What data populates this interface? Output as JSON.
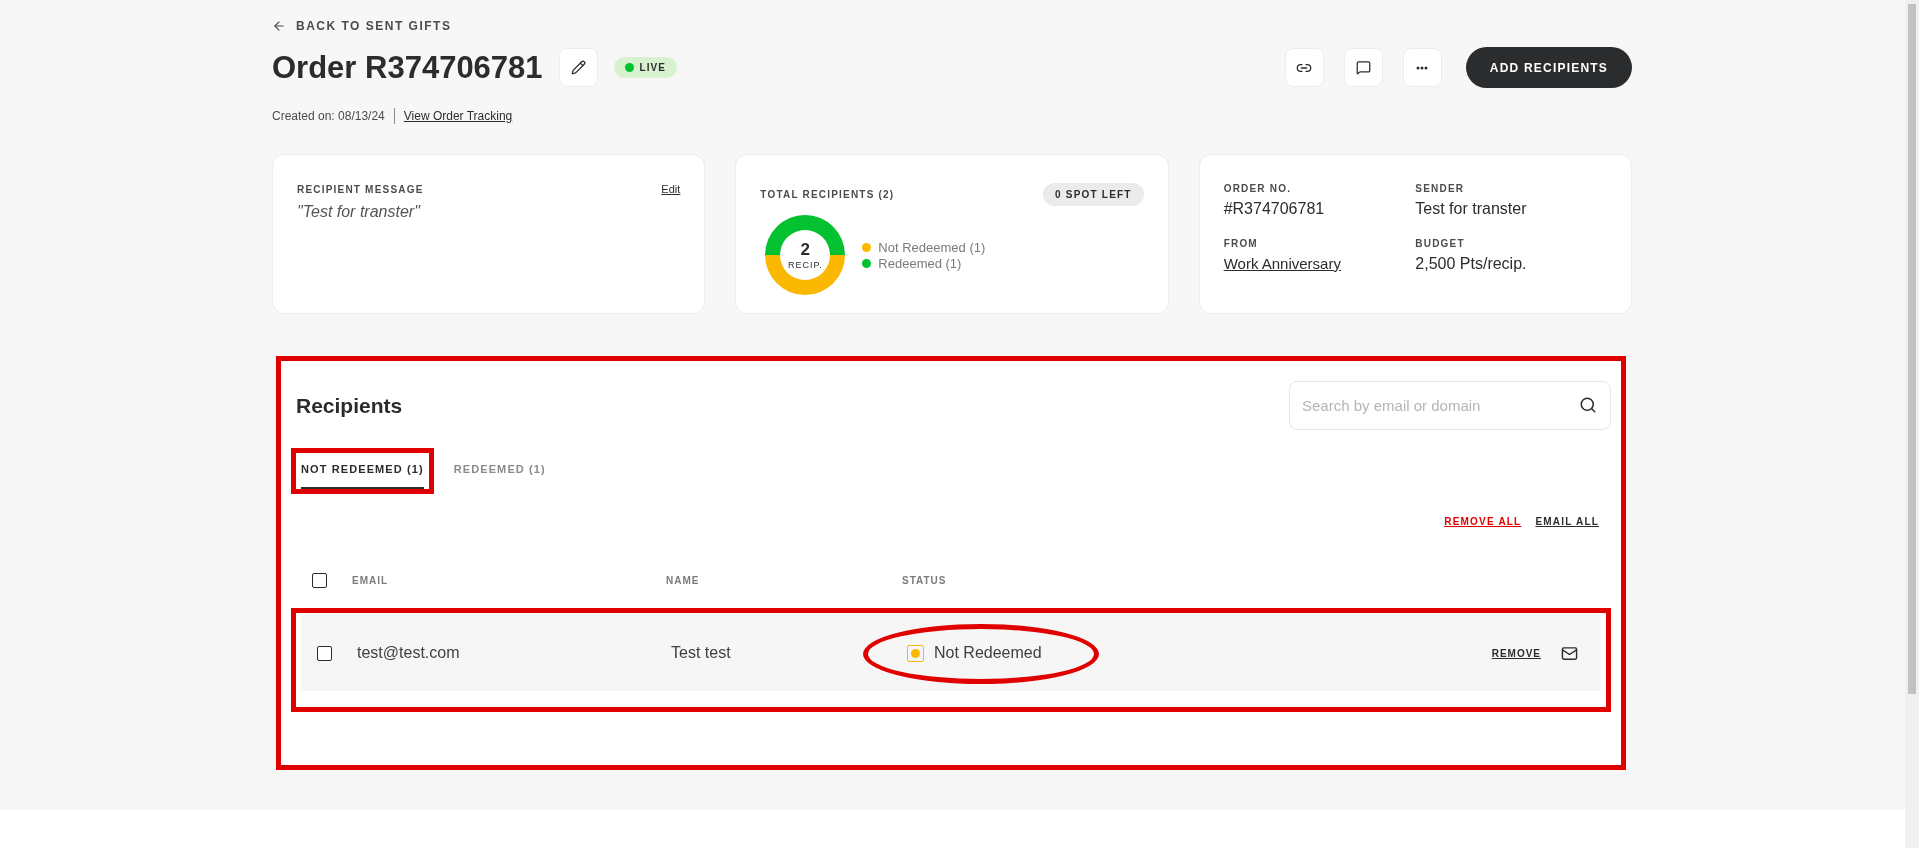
{
  "back_link": "BACK TO SENT GIFTS",
  "title": "Order R374706781",
  "status_badge": "LIVE",
  "created": "Created on: 08/13/24",
  "tracking_link": "View Order Tracking",
  "primary_button": "ADD RECIPIENTS",
  "message_card": {
    "label": "RECIPIENT MESSAGE",
    "edit": "Edit",
    "message": "\"Test for transter\""
  },
  "recipients_card": {
    "label": "TOTAL RECIPIENTS (2)",
    "spots": "0 SPOT LEFT",
    "total": "2",
    "total_label": "RECIP.",
    "legend": [
      {
        "label": "Not Redeemed (1)",
        "color": "#fbb800"
      },
      {
        "label": "Redeemed (1)",
        "color": "#04c12f"
      }
    ]
  },
  "order_card": [
    {
      "label": "ORDER NO.",
      "value": "#R374706781",
      "link": false
    },
    {
      "label": "SENDER",
      "value": "Test for transter",
      "link": false
    },
    {
      "label": "FROM",
      "value": "Work Anniversary",
      "link": true
    },
    {
      "label": "BUDGET",
      "value": "2,500 Pts/recip.",
      "link": false
    }
  ],
  "recipients": {
    "title": "Recipients",
    "search": {
      "placeholder": "Search by email or domain"
    },
    "tabs": [
      {
        "label": "NOT REDEEMED (1)",
        "selected": true
      },
      {
        "label": "REDEEMED (1)",
        "selected": false
      }
    ],
    "remove_all": "REMOVE ALL",
    "email_all": "EMAIL ALL",
    "select_all_checked": false,
    "columns": [
      "EMAIL",
      "NAME",
      "STATUS"
    ],
    "rows": [
      {
        "email": "test@test.com",
        "name": "Test test",
        "status": "Not Redeemed",
        "checked": false,
        "action": "REMOVE"
      }
    ]
  }
}
